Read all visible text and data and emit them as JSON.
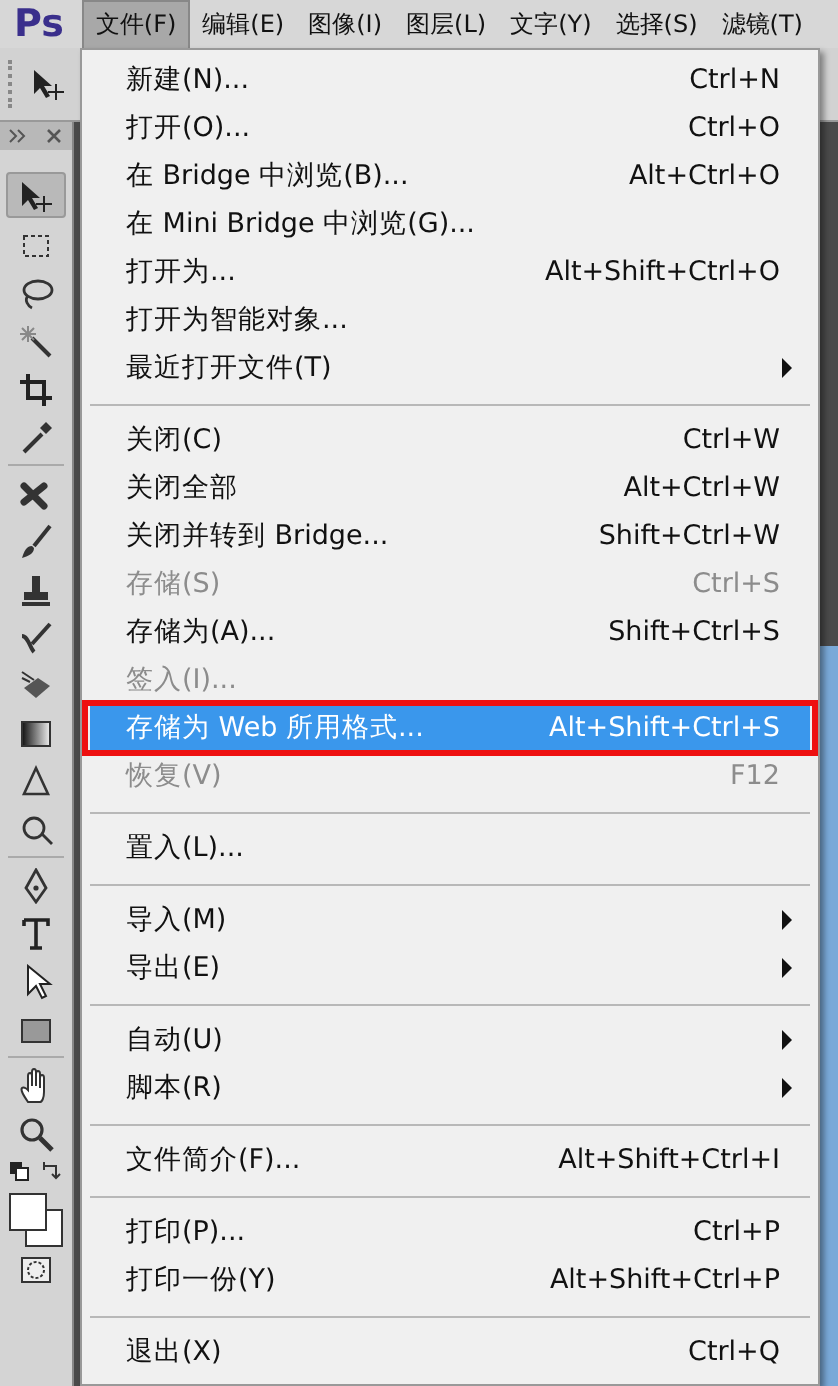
{
  "app_logo": "Ps",
  "menubar": [
    {
      "label": "文件(F)",
      "selected": true
    },
    {
      "label": "编辑(E)",
      "selected": false
    },
    {
      "label": "图像(I)",
      "selected": false
    },
    {
      "label": "图层(L)",
      "selected": false
    },
    {
      "label": "文字(Y)",
      "selected": false
    },
    {
      "label": "选择(S)",
      "selected": false
    },
    {
      "label": "滤镜(T)",
      "selected": false
    }
  ],
  "menu": [
    {
      "kind": "item",
      "label": "新建(N)...",
      "shortcut": "Ctrl+N",
      "disabled": false,
      "selected": false,
      "submenu": false,
      "outlined": false
    },
    {
      "kind": "item",
      "label": "打开(O)...",
      "shortcut": "Ctrl+O",
      "disabled": false,
      "selected": false,
      "submenu": false,
      "outlined": false
    },
    {
      "kind": "item",
      "label": "在 Bridge 中浏览(B)...",
      "shortcut": "Alt+Ctrl+O",
      "disabled": false,
      "selected": false,
      "submenu": false,
      "outlined": false
    },
    {
      "kind": "item",
      "label": "在 Mini Bridge 中浏览(G)...",
      "disabled": false,
      "selected": false,
      "submenu": false,
      "outlined": false
    },
    {
      "kind": "item",
      "label": "打开为...",
      "shortcut": "Alt+Shift+Ctrl+O",
      "disabled": false,
      "selected": false,
      "submenu": false,
      "outlined": false
    },
    {
      "kind": "item",
      "label": "打开为智能对象...",
      "disabled": false,
      "selected": false,
      "submenu": false,
      "outlined": false
    },
    {
      "kind": "item",
      "label": "最近打开文件(T)",
      "disabled": false,
      "selected": false,
      "submenu": true,
      "outlined": false
    },
    {
      "kind": "separator"
    },
    {
      "kind": "item",
      "label": "关闭(C)",
      "shortcut": "Ctrl+W",
      "disabled": false,
      "selected": false,
      "submenu": false,
      "outlined": false
    },
    {
      "kind": "item",
      "label": "关闭全部",
      "shortcut": "Alt+Ctrl+W",
      "disabled": false,
      "selected": false,
      "submenu": false,
      "outlined": false
    },
    {
      "kind": "item",
      "label": "关闭并转到 Bridge...",
      "shortcut": "Shift+Ctrl+W",
      "disabled": false,
      "selected": false,
      "submenu": false,
      "outlined": false
    },
    {
      "kind": "item",
      "label": "存储(S)",
      "shortcut": "Ctrl+S",
      "disabled": true,
      "selected": false,
      "submenu": false,
      "outlined": false
    },
    {
      "kind": "item",
      "label": "存储为(A)...",
      "shortcut": "Shift+Ctrl+S",
      "disabled": false,
      "selected": false,
      "submenu": false,
      "outlined": false
    },
    {
      "kind": "item",
      "label": "签入(I)...",
      "disabled": true,
      "selected": false,
      "submenu": false,
      "outlined": false
    },
    {
      "kind": "item",
      "label": "存储为 Web 所用格式...",
      "shortcut": "Alt+Shift+Ctrl+S",
      "disabled": false,
      "selected": true,
      "submenu": false,
      "outlined": true
    },
    {
      "kind": "item",
      "label": "恢复(V)",
      "shortcut": "F12",
      "disabled": true,
      "selected": false,
      "submenu": false,
      "outlined": false
    },
    {
      "kind": "separator"
    },
    {
      "kind": "item",
      "label": "置入(L)...",
      "disabled": false,
      "selected": false,
      "submenu": false,
      "outlined": false
    },
    {
      "kind": "separator"
    },
    {
      "kind": "item",
      "label": "导入(M)",
      "disabled": false,
      "selected": false,
      "submenu": true,
      "outlined": false
    },
    {
      "kind": "item",
      "label": "导出(E)",
      "disabled": false,
      "selected": false,
      "submenu": true,
      "outlined": false
    },
    {
      "kind": "separator"
    },
    {
      "kind": "item",
      "label": "自动(U)",
      "disabled": false,
      "selected": false,
      "submenu": true,
      "outlined": false
    },
    {
      "kind": "item",
      "label": "脚本(R)",
      "disabled": false,
      "selected": false,
      "submenu": true,
      "outlined": false
    },
    {
      "kind": "separator"
    },
    {
      "kind": "item",
      "label": "文件简介(F)...",
      "shortcut": "Alt+Shift+Ctrl+I",
      "disabled": false,
      "selected": false,
      "submenu": false,
      "outlined": false
    },
    {
      "kind": "separator"
    },
    {
      "kind": "item",
      "label": "打印(P)...",
      "shortcut": "Ctrl+P",
      "disabled": false,
      "selected": false,
      "submenu": false,
      "outlined": false
    },
    {
      "kind": "item",
      "label": "打印一份(Y)",
      "shortcut": "Alt+Shift+Ctrl+P",
      "disabled": false,
      "selected": false,
      "submenu": false,
      "outlined": false
    },
    {
      "kind": "separator"
    },
    {
      "kind": "item",
      "label": "退出(X)",
      "shortcut": "Ctrl+Q",
      "disabled": false,
      "selected": false,
      "submenu": false,
      "outlined": false
    }
  ]
}
